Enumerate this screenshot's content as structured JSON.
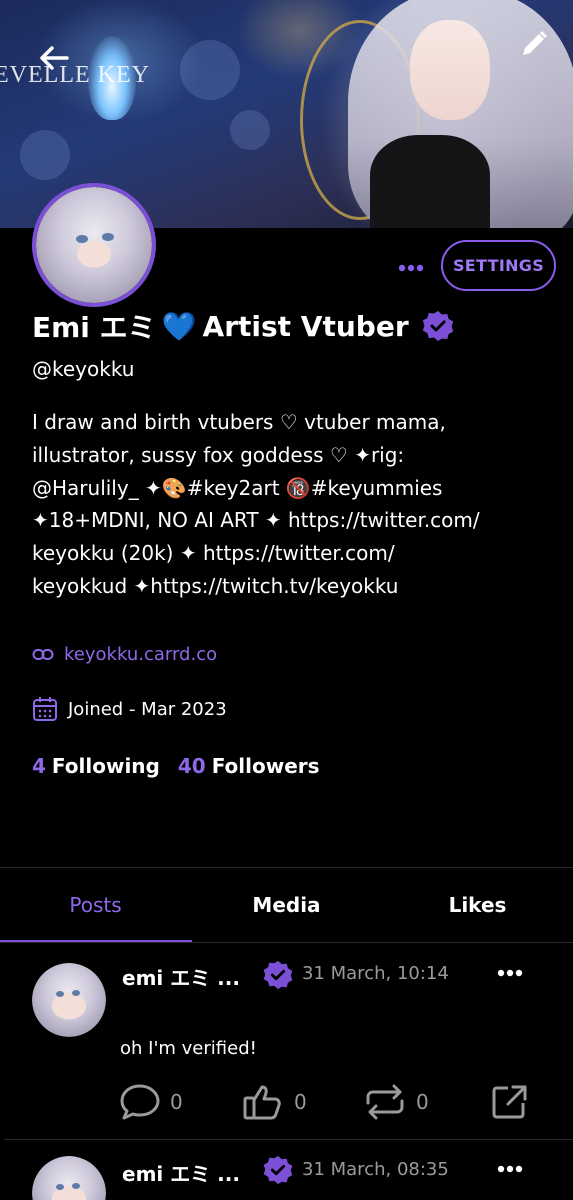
{
  "header": {
    "back_icon": "arrow-left-icon",
    "edit_icon": "pencil-icon",
    "banner_text": "EVELLE KEY"
  },
  "profile": {
    "name_part1": "Emi エミ",
    "heart": "💙",
    "name_part2": "Artist Vtuber",
    "handle": "@keyokku",
    "bio": "I draw and birth vtubers ♡ vtuber mama,\nillustrator, sussy fox goddess ♡ ✦rig:\n@Harulily_ ✦🎨#key2art 🔞#keyummies\n✦18+MDNI, NO AI ART ✦ https://twitter.com/\nkeyokku (20k) ✦ https://twitter.com/\nkeyokkud ✦https://twitch.tv/keyokku",
    "link": "keyokku.carrd.co",
    "joined": "Joined - Mar 2023",
    "following_count": "4",
    "following_label": "Following",
    "followers_count": "40",
    "followers_label": "Followers",
    "settings_label": "SETTINGS",
    "accent": "#8d68e8"
  },
  "tabs": [
    {
      "label": "Posts",
      "active": true
    },
    {
      "label": "Media",
      "active": false
    },
    {
      "label": "Likes",
      "active": false
    }
  ],
  "posts": [
    {
      "author": "emi エミ ...",
      "time": "31 March, 10:14",
      "content": "oh I'm verified!",
      "replies": "0",
      "likes": "0",
      "reposts": "0"
    },
    {
      "author": "emi エミ ...",
      "time": "31 March, 08:35"
    }
  ]
}
